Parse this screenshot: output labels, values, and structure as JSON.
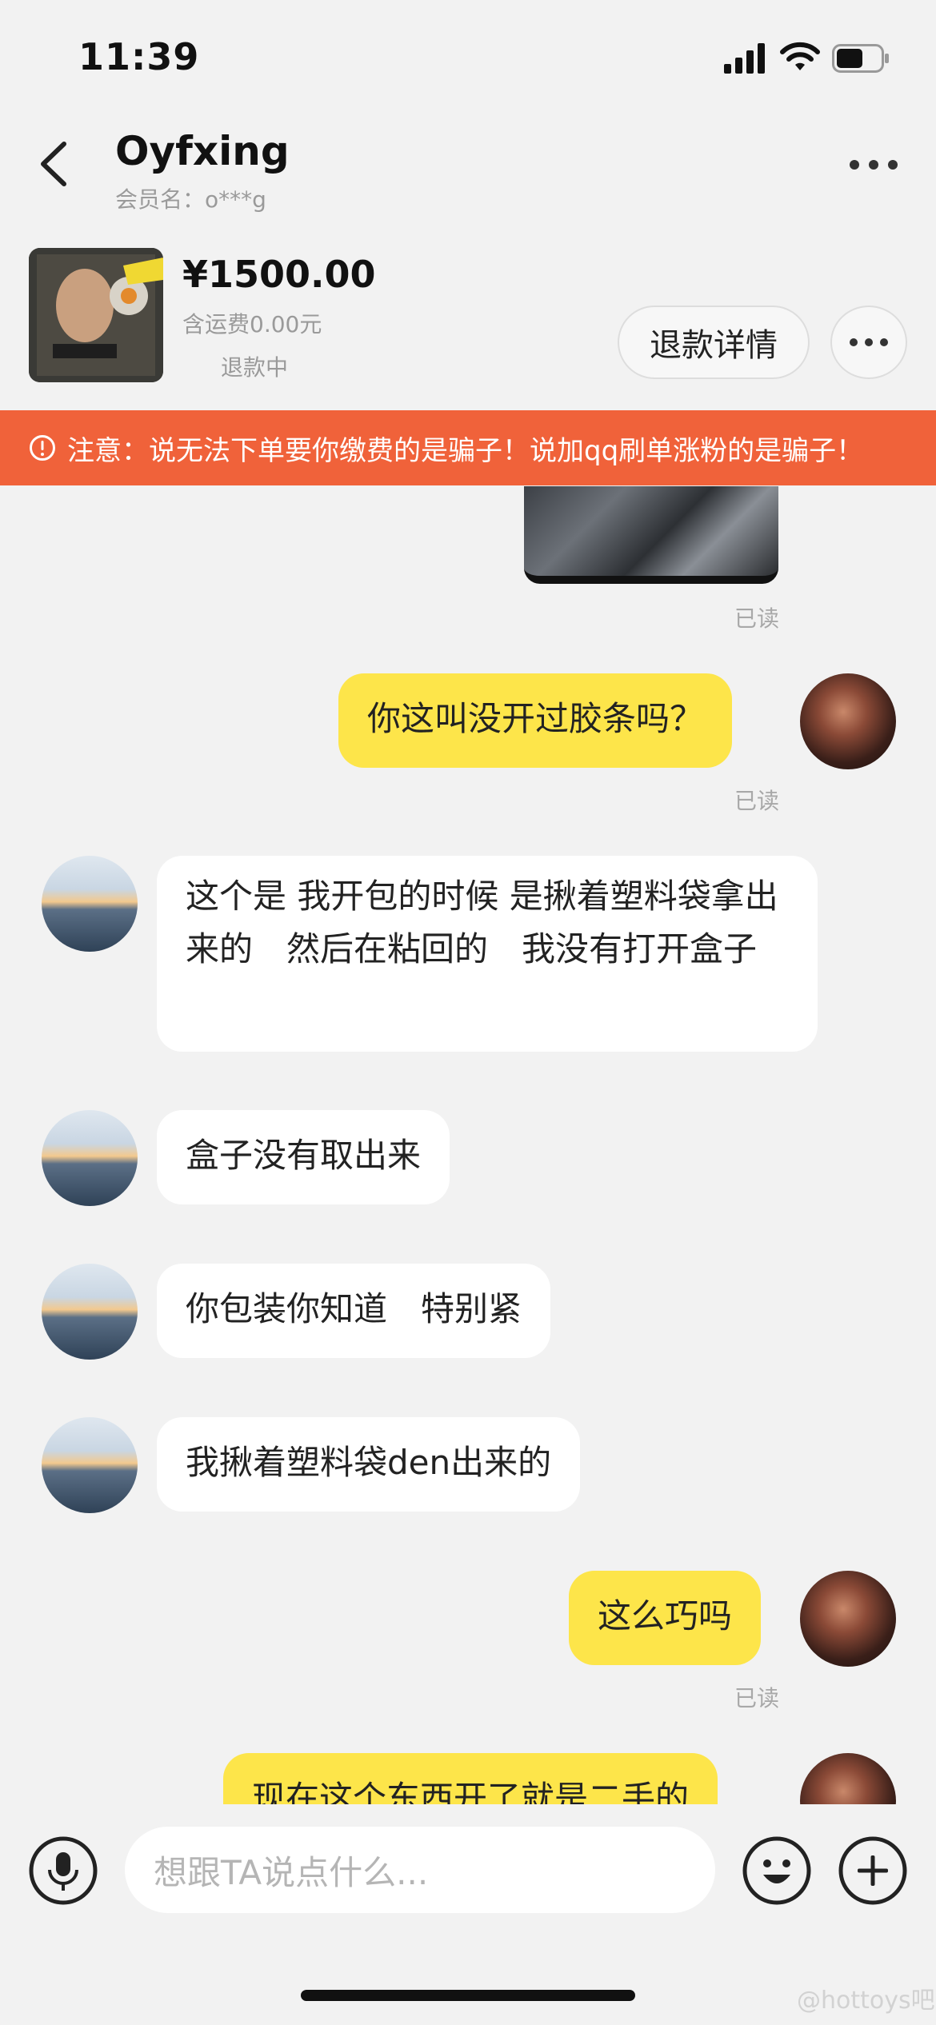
{
  "status_bar": {
    "time": "11:39"
  },
  "header": {
    "name": "Oyfxing",
    "member": "会员名：o***g"
  },
  "product": {
    "price": "¥1500.00",
    "shipping": "含运费0.00元",
    "status": "退款中",
    "refund_button": "退款详情"
  },
  "banner": {
    "text": "注意：说无法下单要你缴费的是骗子！说加qq刷单涨粉的是骗子！"
  },
  "messages": [
    {
      "from": "me",
      "text": "你这叫没开过胶条吗？",
      "read": "已读"
    },
    {
      "from": "them",
      "text": "这个是 我开包的时候 是揪着塑料袋拿出来的　然后在粘回的　我没有打开盒子"
    },
    {
      "from": "them",
      "text": "盒子没有取出来"
    },
    {
      "from": "them",
      "text": "你包装你知道　特别紧"
    },
    {
      "from": "them",
      "text": "我揪着塑料袋den出来的"
    },
    {
      "from": "me",
      "text": "这么巧吗",
      "read": "已读"
    },
    {
      "from": "me",
      "text": "现在这个东西开了就是二手的"
    }
  ],
  "first_read": "已读",
  "composer": {
    "placeholder": "想跟TA说点什么..."
  },
  "watermark": "@hottoys吧"
}
